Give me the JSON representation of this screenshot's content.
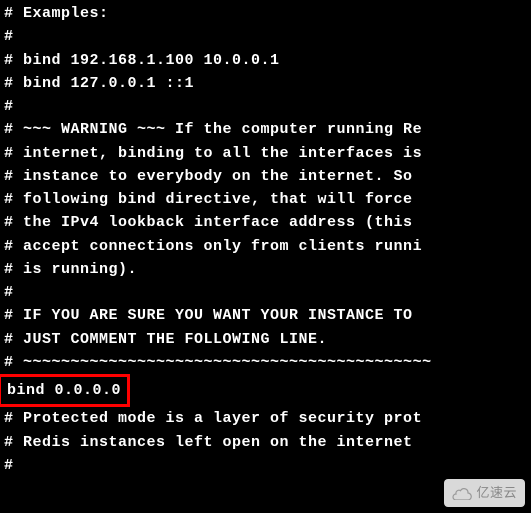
{
  "lines": [
    "# Examples:",
    "#",
    "# bind 192.168.1.100 10.0.0.1",
    "# bind 127.0.0.1 ::1",
    "#",
    "# ~~~ WARNING ~~~ If the computer running Re",
    "# internet, binding to all the interfaces is",
    "# instance to everybody on the internet. So ",
    "# following bind directive, that will force ",
    "# the IPv4 lookback interface address (this ",
    "# accept connections only from clients runni",
    "# is running).",
    "#",
    "# IF YOU ARE SURE YOU WANT YOUR INSTANCE TO ",
    "# JUST COMMENT THE FOLLOWING LINE.",
    "# ~~~~~~~~~~~~~~~~~~~~~~~~~~~~~~~~~~~~~~~~~~~"
  ],
  "highlighted_line": "bind 0.0.0.0",
  "lines_after": [
    "",
    "# Protected mode is a layer of security prot",
    "# Redis instances left open on the internet ",
    "#"
  ],
  "watermark": {
    "text": "亿速云"
  }
}
